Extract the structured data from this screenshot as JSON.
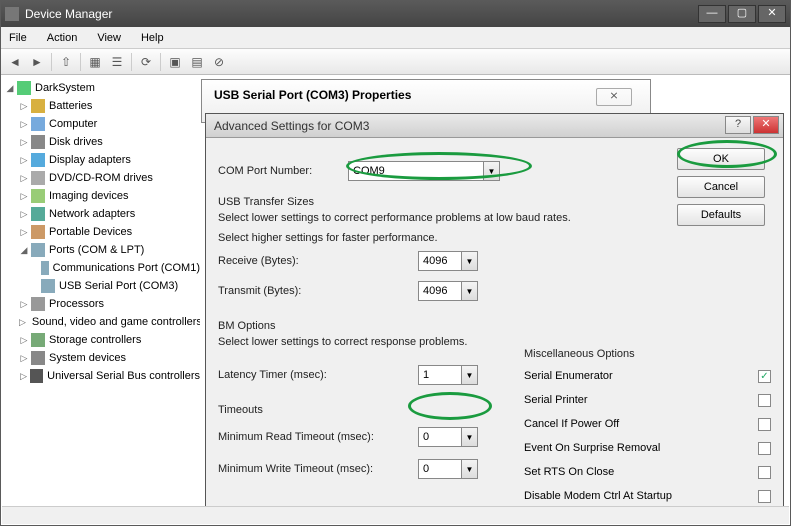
{
  "window": {
    "title": "Device Manager"
  },
  "menu": {
    "file": "File",
    "action": "Action",
    "view": "View",
    "help": "Help"
  },
  "tree": {
    "root": "DarkSystem",
    "items": [
      "Batteries",
      "Computer",
      "Disk drives",
      "Display adapters",
      "DVD/CD-ROM drives",
      "Imaging devices",
      "Network adapters",
      "Portable Devices",
      "Ports (COM & LPT)",
      "Processors",
      "Sound, video and game controllers",
      "Storage controllers",
      "System devices",
      "Universal Serial Bus controllers"
    ],
    "ports_children": [
      "Communications Port (COM1)",
      "USB Serial Port (COM3)"
    ]
  },
  "props": {
    "title": "USB Serial Port (COM3) Properties"
  },
  "adv": {
    "title": "Advanced Settings for COM3",
    "com_port_label": "COM Port Number:",
    "com_port_value": "COM9",
    "usb_section": "USB Transfer Sizes",
    "usb_hint1": "Select lower settings to correct performance problems at low baud rates.",
    "usb_hint2": "Select higher settings for faster performance.",
    "receive_label": "Receive (Bytes):",
    "receive_value": "4096",
    "transmit_label": "Transmit (Bytes):",
    "transmit_value": "4096",
    "bm_section": "BM Options",
    "bm_hint": "Select lower settings to correct response problems.",
    "latency_label": "Latency Timer (msec):",
    "latency_value": "1",
    "timeouts_section": "Timeouts",
    "min_read_label": "Minimum Read Timeout (msec):",
    "min_read_value": "0",
    "min_write_label": "Minimum Write Timeout (msec):",
    "min_write_value": "0",
    "misc_section": "Miscellaneous Options",
    "misc": {
      "serial_enum": "Serial Enumerator",
      "serial_printer": "Serial Printer",
      "cancel_poweroff": "Cancel If Power Off",
      "event_surprise": "Event On Surprise Removal",
      "set_rts": "Set RTS On Close",
      "disable_modem": "Disable Modem Ctrl At Startup"
    },
    "ok": "OK",
    "cancel": "Cancel",
    "defaults": "Defaults"
  }
}
